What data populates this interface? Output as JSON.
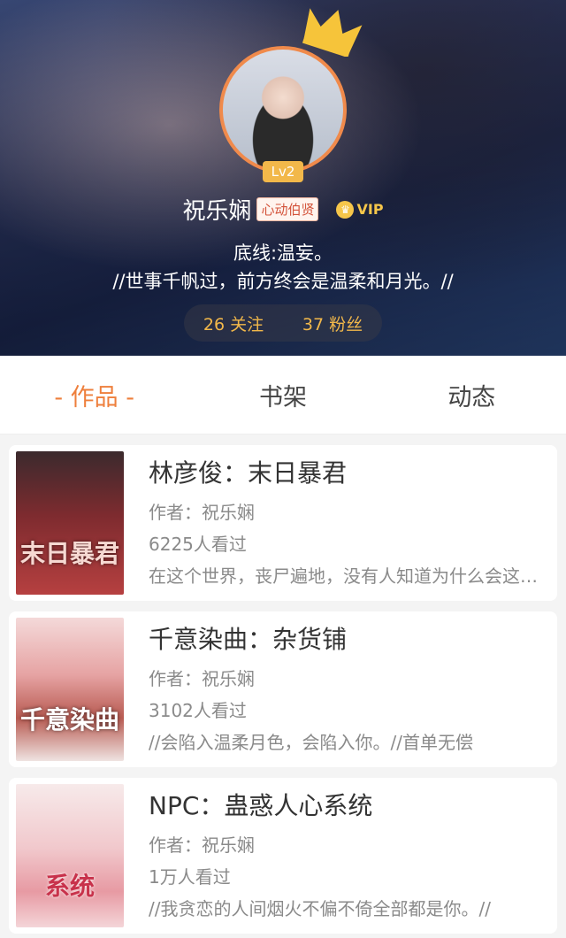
{
  "profile": {
    "level": "Lv2",
    "username": "祝乐娴",
    "title_badge": "心动伯贤",
    "vip_label": "VIP",
    "bio_line1": "底线:温妄。",
    "bio_line2": "//世事千帆过，前方终会是温柔和月光。//",
    "following": "26 关注",
    "followers": "37 粉丝"
  },
  "tabs": [
    {
      "label": "- 作品 -",
      "active": true
    },
    {
      "label": "书架",
      "active": false
    },
    {
      "label": "动态",
      "active": false
    }
  ],
  "works": [
    {
      "title": "林彦俊：末日暴君",
      "author": "作者：祝乐娴",
      "views": "6225人看过",
      "desc": "在这个世界，丧尸遍地，没有人知道为什么会这样，只知道",
      "cover_text": "末日暴君"
    },
    {
      "title": "千意染曲：杂货铺",
      "author": "作者：祝乐娴",
      "views": "3102人看过",
      "desc": "//会陷入温柔月色，会陷入你。//首单无偿",
      "cover_text": "千意染曲"
    },
    {
      "title": "NPC：蛊惑人心系统",
      "author": "作者：祝乐娴",
      "views": "1万人看过",
      "desc": "//我贪恋的人间烟火不偏不倚全部都是你。//",
      "cover_text": "系统"
    }
  ],
  "colors": {
    "accent": "#ee7f3c",
    "level_badge": "#f2b84a",
    "vip": "#f6c64a"
  }
}
